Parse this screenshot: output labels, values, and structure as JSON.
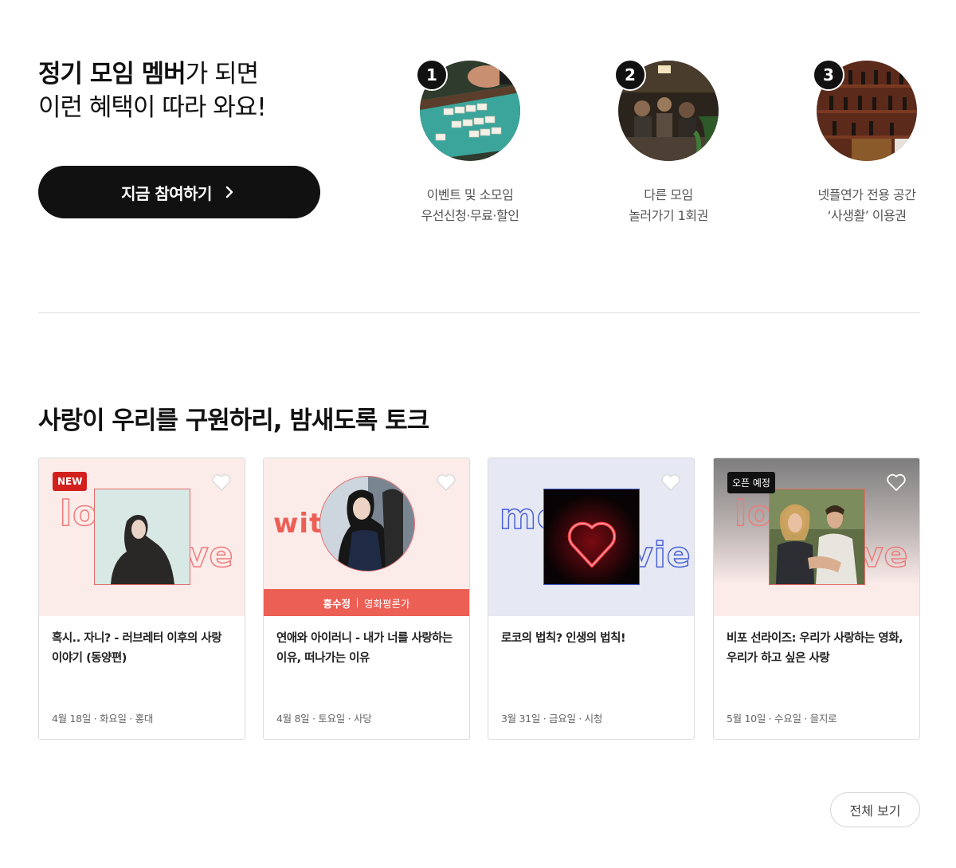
{
  "benefits": {
    "title_line1_bold": "정기 모임 멤버",
    "title_line1_rest": "가 되면",
    "title_line2": "이런 혜택이 따라 와요!",
    "join_button_label": "지금 참여하기",
    "perks": [
      {
        "number": "1",
        "caption_line1": "이벤트 및 소모임",
        "caption_line2": "우선신청·무료·할인"
      },
      {
        "number": "2",
        "caption_line1": "다른 모임",
        "caption_line2": "놀러가기 1회권"
      },
      {
        "number": "3",
        "caption_line1": "넷플연가 전용 공간",
        "caption_line2": "‘사생활’ 이용권"
      }
    ]
  },
  "section": {
    "title": "사랑이 우리를 구원하리, 밤새도록 토크"
  },
  "cards": [
    {
      "badge": "NEW",
      "word_left": "lo",
      "word_right": "ve",
      "title": "혹시.. 자니? - 러브레터 이후의 사랑 이야기 (동양편)",
      "meta": "4월 18일 · 화요일 · 홍대"
    },
    {
      "word_left": "with",
      "host_name": "홍수정",
      "host_role": "영화평론가",
      "title": "연애와 아이러니 - 내가 너를 사랑하는 이유, 떠나가는 이유",
      "meta": "4월 8일 · 토요일 · 사당"
    },
    {
      "word_left": "mo",
      "word_right": "vie",
      "title": "로코의 법칙? 인생의 법칙!",
      "meta": "3월 31일 · 금요일 · 시청"
    },
    {
      "badge": "오픈 예정",
      "word_left": "lo",
      "word_right": "ve",
      "title": "비포 선라이즈: 우리가 사랑하는 영화, 우리가 하고 싶은 사랑",
      "meta": "5월 10일 · 수요일 · 을지로"
    }
  ],
  "see_all_label": "전체 보기",
  "colors": {
    "accent_red": "#d2201d",
    "host_bar": "#ec5f55",
    "card_pink_bg": "#fbecea",
    "card_blue_bg": "#e6e9f4"
  }
}
